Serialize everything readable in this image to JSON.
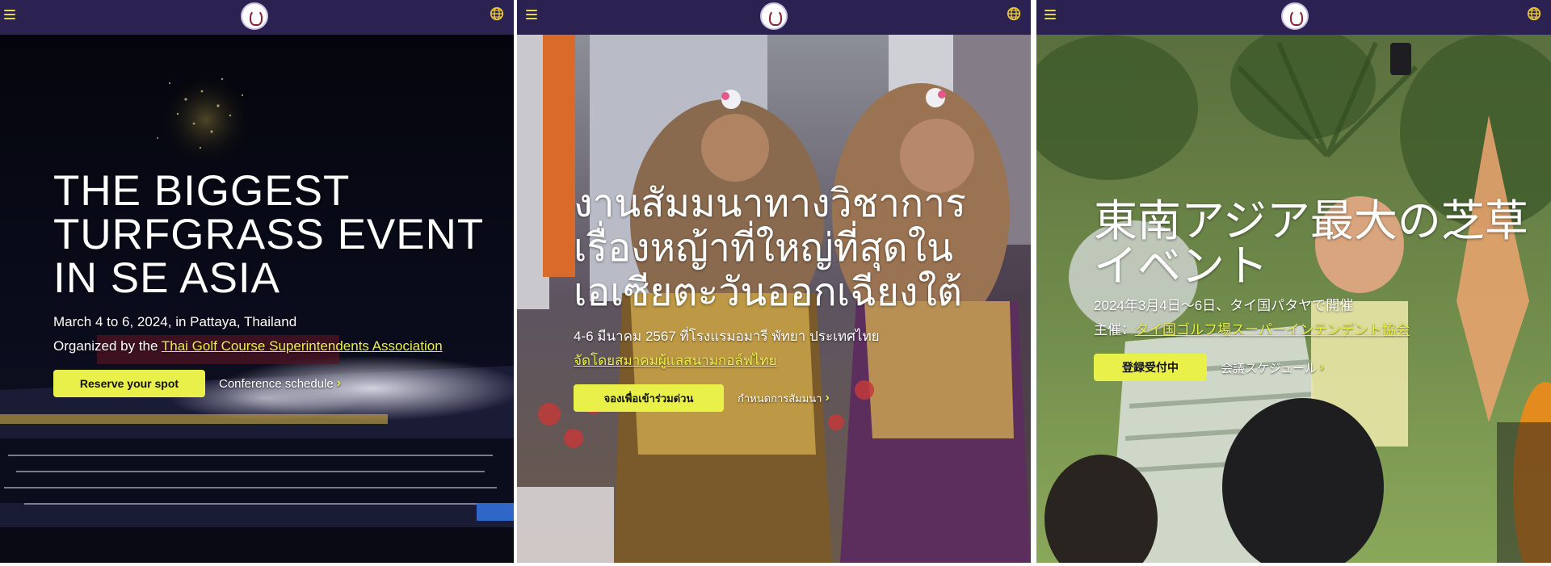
{
  "brand": {
    "accent": "#eaf04a",
    "header_bg": "#2c2251"
  },
  "panels": [
    {
      "lang": "en",
      "headline": "THE BIGGEST TURFGRASS EVENT IN SE ASIA",
      "date_line": "March 4 to 6, 2024, in Pattaya, Thailand",
      "organizer_prefix": "Organized by the ",
      "organizer_link": "Thai Golf Course Superintendents Association",
      "cta_label": "Reserve your spot",
      "schedule_label": "Conference schedule",
      "chevron": "›",
      "background": "stadium-fireworks-night"
    },
    {
      "lang": "th",
      "headline": "งานสัมมนาทางวิชาการเรื่องหญ้าที่ใหญ่ที่สุดในเอเซียตะวันออกเฉียงใต้",
      "date_line": "4-6 มีนาคม 2567 ที่โรงแรมอมารี พัทยา ประเทศไทย",
      "organizer_prefix": "",
      "organizer_link": "จัดโดยสมาคมผู้แลสนามกอล์ฟไทย",
      "cta_label": "จองเพื่อเข้าร่วมด่วน",
      "schedule_label": "กำหนดการสัมมนา",
      "chevron": "›",
      "background": "thai-dancers"
    },
    {
      "lang": "ja",
      "headline": "東南アジア最大の芝草イベント",
      "date_line": "2024年3月4日〜6日、タイ国パタヤで開催",
      "organizer_prefix": "主催：",
      "organizer_link": "タイ国ゴルフ場スーパーインテンデント協会",
      "cta_label": "登録受付中",
      "schedule_label": "会議スケジュール",
      "chevron": "›",
      "background": "garden-crowd"
    }
  ]
}
